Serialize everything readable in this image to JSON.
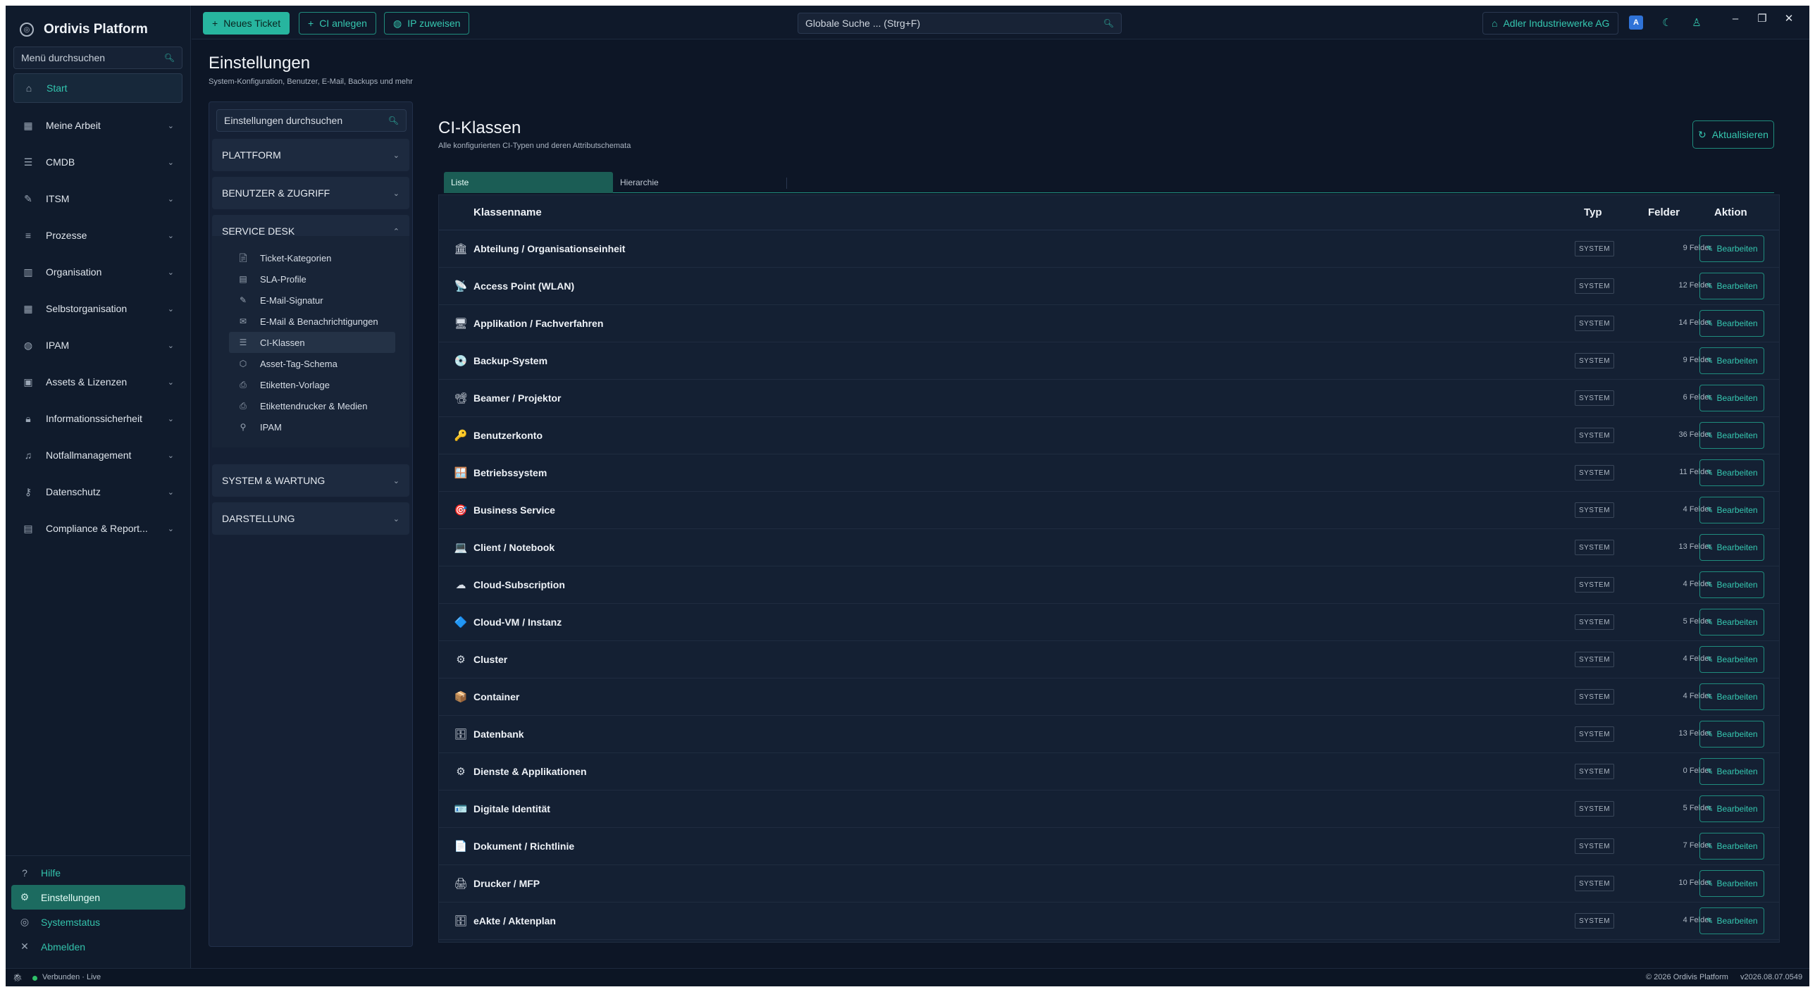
{
  "app": {
    "name": "Ordivis Platform"
  },
  "sidebar": {
    "search_placeholder": "Menü durchsuchen",
    "start": "Start",
    "items": [
      {
        "label": "Meine Arbeit",
        "icon": "calendar-icon"
      },
      {
        "label": "CMDB",
        "icon": "list-icon"
      },
      {
        "label": "ITSM",
        "icon": "wrench-icon"
      },
      {
        "label": "Prozesse",
        "icon": "process-icon"
      },
      {
        "label": "Organisation",
        "icon": "building-icon"
      },
      {
        "label": "Selbstorganisation",
        "icon": "calendar-icon"
      },
      {
        "label": "IPAM",
        "icon": "globe-icon"
      },
      {
        "label": "Assets & Lizenzen",
        "icon": "box-icon"
      },
      {
        "label": "Informationssicherheit",
        "icon": "lock-icon"
      },
      {
        "label": "Notfallmanagement",
        "icon": "bell-icon"
      },
      {
        "label": "Datenschutz",
        "icon": "key-icon"
      },
      {
        "label": "Compliance & Report...",
        "icon": "report-icon"
      }
    ],
    "bottom": {
      "help": "Hilfe",
      "settings": "Einstellungen",
      "status": "Systemstatus",
      "logout": "Abmelden"
    }
  },
  "topbar": {
    "new_ticket": "Neues Ticket",
    "ci_create": "CI anlegen",
    "ip_assign": "IP zuweisen",
    "search_placeholder": "Globale Suche ... (Strg+F)",
    "org": "Adler Industriewerke AG"
  },
  "page": {
    "title": "Einstellungen",
    "subtitle": "System-Konfiguration, Benutzer, E-Mail, Backups und mehr"
  },
  "settings": {
    "search_placeholder": "Einstellungen durchsuchen",
    "sections": {
      "platform": "PLATTFORM",
      "users": "BENUTZER & ZUGRIFF",
      "service_desk": "SERVICE DESK",
      "system": "SYSTEM & WARTUNG",
      "display": "DARSTELLUNG"
    },
    "service_desk_items": [
      "Ticket-Kategorien",
      "SLA-Profile",
      "E-Mail-Signatur",
      "E-Mail & Benachrichtigungen",
      "CI-Klassen",
      "Asset-Tag-Schema",
      "Etiketten-Vorlage",
      "Etikettendrucker & Medien",
      "IPAM"
    ]
  },
  "main": {
    "title": "CI-Klassen",
    "subtitle": "Alle konfigurierten CI-Typen und deren Attributschemata",
    "refresh": "Aktualisieren",
    "tabs": [
      "Liste",
      "Hierarchie"
    ],
    "columns": {
      "name": "Klassenname",
      "type": "Typ",
      "fields": "Felder",
      "action": "Aktion"
    },
    "edit_label": "Bearbeiten",
    "rows": [
      {
        "icon": "🏛",
        "name": "Abteilung / Organisationseinheit",
        "type": "SYSTEM",
        "fields": "9 Felder"
      },
      {
        "icon": "📡",
        "name": "Access Point (WLAN)",
        "type": "SYSTEM",
        "fields": "12 Felder"
      },
      {
        "icon": "🖥",
        "name": "Applikation / Fachverfahren",
        "type": "SYSTEM",
        "fields": "14 Felder"
      },
      {
        "icon": "💿",
        "name": "Backup-System",
        "type": "SYSTEM",
        "fields": "9 Felder"
      },
      {
        "icon": "📽",
        "name": "Beamer / Projektor",
        "type": "SYSTEM",
        "fields": "6 Felder"
      },
      {
        "icon": "🔑",
        "name": "Benutzerkonto",
        "type": "SYSTEM",
        "fields": "36 Felder"
      },
      {
        "icon": "🪟",
        "name": "Betriebssystem",
        "type": "SYSTEM",
        "fields": "11 Felder"
      },
      {
        "icon": "🎯",
        "name": "Business Service",
        "type": "SYSTEM",
        "fields": "4 Felder"
      },
      {
        "icon": "💻",
        "name": "Client / Notebook",
        "type": "SYSTEM",
        "fields": "13 Felder"
      },
      {
        "icon": "☁",
        "name": "Cloud-Subscription",
        "type": "SYSTEM",
        "fields": "4 Felder"
      },
      {
        "icon": "🔷",
        "name": "Cloud-VM / Instanz",
        "type": "SYSTEM",
        "fields": "5 Felder"
      },
      {
        "icon": "⚙",
        "name": "Cluster",
        "type": "SYSTEM",
        "fields": "4 Felder"
      },
      {
        "icon": "📦",
        "name": "Container",
        "type": "SYSTEM",
        "fields": "4 Felder"
      },
      {
        "icon": "🗄",
        "name": "Datenbank",
        "type": "SYSTEM",
        "fields": "13 Felder"
      },
      {
        "icon": "⚙",
        "name": "Dienste & Applikationen",
        "type": "SYSTEM",
        "fields": "0 Felder"
      },
      {
        "icon": "🪪",
        "name": "Digitale Identität",
        "type": "SYSTEM",
        "fields": "5 Felder"
      },
      {
        "icon": "📄",
        "name": "Dokument / Richtlinie",
        "type": "SYSTEM",
        "fields": "7 Felder"
      },
      {
        "icon": "🖨",
        "name": "Drucker / MFP",
        "type": "SYSTEM",
        "fields": "10 Felder"
      },
      {
        "icon": "🗄",
        "name": "eAkte / Aktenplan",
        "type": "SYSTEM",
        "fields": "4 Felder"
      }
    ]
  },
  "statusbar": {
    "connection": "Verbunden · Live",
    "copyright": "© 2026 Ordivis Platform",
    "version": "v2026.08.07.0549"
  },
  "colors": {
    "accent": "#27b59f",
    "background": "#0d1626",
    "sidebar": "#101b2c"
  }
}
